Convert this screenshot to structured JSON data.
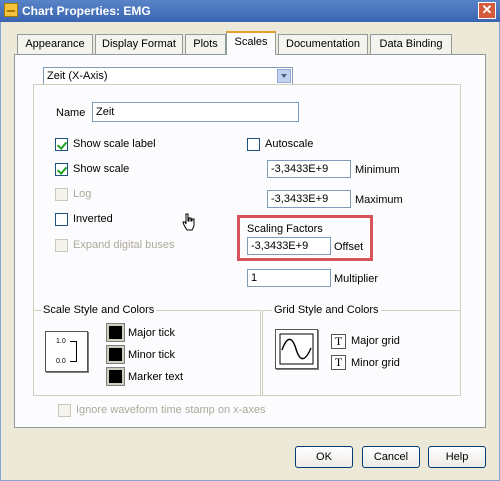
{
  "window": {
    "title": "Chart Properties: EMG",
    "close_label": "✕"
  },
  "tabs": [
    {
      "label": "Appearance"
    },
    {
      "label": "Display Format"
    },
    {
      "label": "Plots"
    },
    {
      "label": "Scales",
      "active": true
    },
    {
      "label": "Documentation"
    },
    {
      "label": "Data Binding"
    }
  ],
  "scale_select": {
    "value": "Zeit (X-Axis)"
  },
  "name_field": {
    "label": "Name",
    "value": "Zeit"
  },
  "checkboxes": {
    "show_scale_label": {
      "label": "Show scale label",
      "checked": true
    },
    "show_scale": {
      "label": "Show scale",
      "checked": true
    },
    "log": {
      "label": "Log",
      "checked": false,
      "disabled": true
    },
    "inverted": {
      "label": "Inverted",
      "checked": false
    },
    "expand_digital_buses": {
      "label": "Expand digital buses",
      "checked": false,
      "disabled": true
    },
    "autoscale": {
      "label": "Autoscale",
      "checked": false
    },
    "ignore_timestamp": {
      "label": "Ignore waveform time stamp on x-axes",
      "checked": false,
      "disabled": true
    }
  },
  "range": {
    "minimum": {
      "value": "-3,3433E+9",
      "label": "Minimum"
    },
    "maximum": {
      "value": "-3,3433E+9",
      "label": "Maximum"
    }
  },
  "scaling_factors": {
    "title": "Scaling Factors",
    "offset": {
      "value": "-3,3433E+9",
      "label": "Offset"
    },
    "multiplier": {
      "value": "1",
      "label": "Multiplier"
    }
  },
  "scale_style": {
    "title": "Scale Style and Colors",
    "style_top": "1.0",
    "style_bottom": "0.0",
    "colors": [
      {
        "label": "Major tick",
        "color": "#000000"
      },
      {
        "label": "Minor tick",
        "color": "#000000"
      },
      {
        "label": "Marker text",
        "color": "#000000"
      }
    ]
  },
  "grid_style": {
    "title": "Grid Style and Colors",
    "major": {
      "glyph": "T",
      "label": "Major grid"
    },
    "minor": {
      "glyph": "T",
      "label": "Minor grid"
    }
  },
  "buttons": {
    "ok": "OK",
    "cancel": "Cancel",
    "help": "Help"
  },
  "accent_colors": {
    "highlight": "#d9545a",
    "active_tab": "#e6a02c",
    "checkmark": "#21a121"
  }
}
